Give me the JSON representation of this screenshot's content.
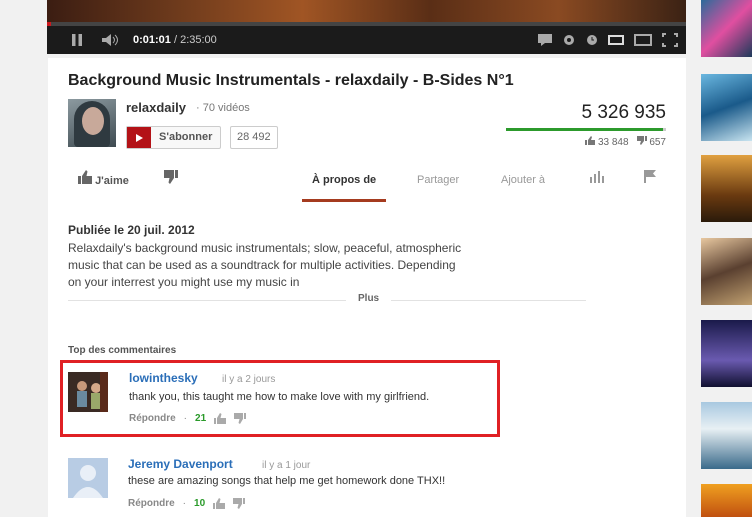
{
  "player": {
    "current_time": "0:01:01",
    "total_time": "/ 2:35:00",
    "progress_fraction": 0.007
  },
  "video": {
    "title": "Background Music Instrumentals - relaxdaily - B-Sides N°1",
    "channel": "relaxdaily",
    "video_count": "· 70 vidéos",
    "subscribe_label": "S'abonner",
    "subscriber_count": "28 492",
    "views": "5 326 935",
    "likes": "33 848",
    "dislikes": "657",
    "like_fraction": 0.981
  },
  "tabs": {
    "like": "J'aime",
    "about": "À propos de",
    "share": "Partager",
    "add_to": "Ajouter à"
  },
  "description": {
    "published": "Publiée le 20 juil. 2012",
    "text": "Relaxdaily's background music instrumentals; slow, peaceful, atmospheric music that can be used as a soundtrack for multiple activities. Depending on your interrest you might use my music in",
    "more": "Plus"
  },
  "comments": {
    "header": "Top des commentaires",
    "items": [
      {
        "author": "lowinthesky",
        "date": "il y a 2 jours",
        "text": "thank you, this taught me how to make love with my girlfriend.",
        "reply": "Répondre",
        "score": "21"
      },
      {
        "author": "Jeremy Davenport",
        "date": "il y a 1 jour",
        "text": "these are amazing songs that help me get homework done THX!!",
        "reply": "Répondre",
        "score": "10"
      }
    ]
  },
  "colors": {
    "accent_red": "#cc181e",
    "highlight_border": "#e02024",
    "link_blue": "#2a6eb8",
    "like_green": "#2c9a2c"
  }
}
